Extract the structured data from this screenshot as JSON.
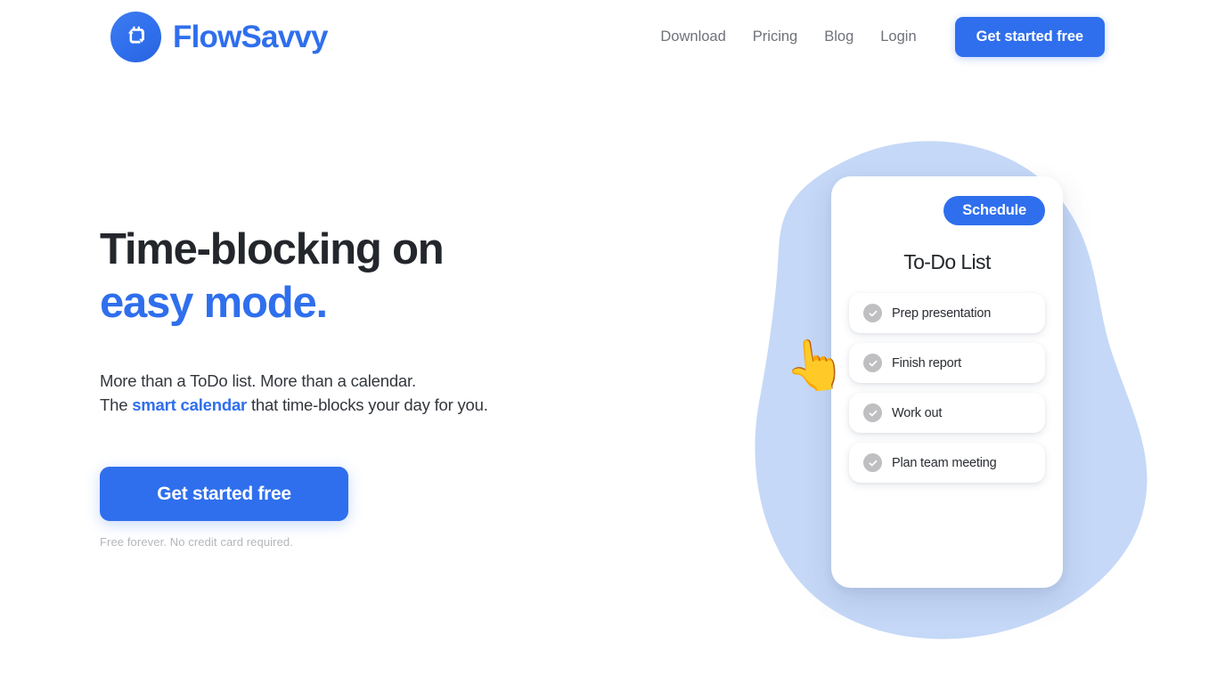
{
  "brand": {
    "name": "FlowSavvy",
    "icon": "calendar-refresh-icon",
    "color": "#2f6fed"
  },
  "header": {
    "nav_links": [
      {
        "label": "Download",
        "name": "nav-link-download"
      },
      {
        "label": "Pricing",
        "name": "nav-link-pricing"
      },
      {
        "label": "Blog",
        "name": "nav-link-blog"
      },
      {
        "label": "Login",
        "name": "nav-link-login"
      }
    ],
    "cta_label": "Get started free"
  },
  "hero": {
    "title_lead": "Time-blocking on ",
    "title_accent": "easy mode.",
    "sub_line1": "More than a ToDo list. More than a calendar.",
    "sub_line2_pre": "The ",
    "sub_line2_accent": "smart calendar",
    "sub_line2_post": " that time-blocks your day for you.",
    "cta_label": "Get started free",
    "fineprint": "Free forever. No credit card required."
  },
  "illustration": {
    "blob_color": "#c5d8f7",
    "pointer_hand": "👆",
    "card": {
      "schedule_label": "Schedule",
      "heading": "To-Do List",
      "items": [
        {
          "label": "Prep presentation"
        },
        {
          "label": "Finish report"
        },
        {
          "label": "Work out"
        },
        {
          "label": "Plan team meeting"
        }
      ]
    }
  }
}
